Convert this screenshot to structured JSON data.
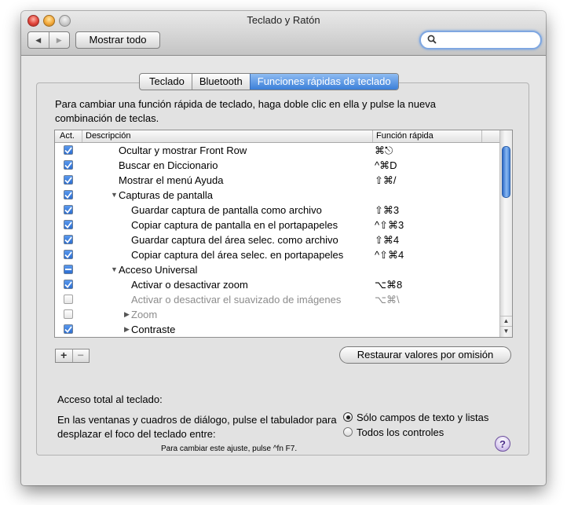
{
  "window": {
    "title": "Teclado y Ratón",
    "show_all_label": "Mostrar todo",
    "search_placeholder": ""
  },
  "tabs": [
    {
      "label": "Teclado",
      "active": false
    },
    {
      "label": "Bluetooth",
      "active": false
    },
    {
      "label": "Funciones rápidas de teclado",
      "active": true
    }
  ],
  "instruction": "Para cambiar una función rápida de teclado, haga doble clic en ella y pulse la nueva combinación de teclas.",
  "table": {
    "headers": {
      "active": "Act.",
      "description": "Descripción",
      "shortcut": "Función rápida"
    },
    "rows": [
      {
        "state": "on",
        "indent": 1,
        "disclosure": "",
        "description": "Ocultar y mostrar Front Row",
        "shortcut": "⌘⎋",
        "dim": false
      },
      {
        "state": "on",
        "indent": 1,
        "disclosure": "",
        "description": "Buscar en Diccionario",
        "shortcut": "^⌘D",
        "dim": false
      },
      {
        "state": "on",
        "indent": 1,
        "disclosure": "",
        "description": "Mostrar el menú Ayuda",
        "shortcut": "⇧⌘/",
        "dim": false
      },
      {
        "state": "on",
        "indent": 0,
        "disclosure": "▼",
        "description": "Capturas de pantalla",
        "shortcut": "",
        "dim": false
      },
      {
        "state": "on",
        "indent": 2,
        "disclosure": "",
        "description": "Guardar captura de pantalla como archivo",
        "shortcut": "⇧⌘3",
        "dim": false
      },
      {
        "state": "on",
        "indent": 2,
        "disclosure": "",
        "description": "Copiar captura de pantalla en el portapapeles",
        "shortcut": "^⇧⌘3",
        "dim": false
      },
      {
        "state": "on",
        "indent": 2,
        "disclosure": "",
        "description": "Guardar captura del área selec. como archivo",
        "shortcut": "⇧⌘4",
        "dim": false
      },
      {
        "state": "on",
        "indent": 2,
        "disclosure": "",
        "description": "Copiar captura del área selec. en portapapeles",
        "shortcut": "^⇧⌘4",
        "dim": false
      },
      {
        "state": "mixed",
        "indent": 0,
        "disclosure": "▼",
        "description": "Acceso Universal",
        "shortcut": "",
        "dim": false
      },
      {
        "state": "on",
        "indent": 2,
        "disclosure": "",
        "description": "Activar o desactivar zoom",
        "shortcut": "⌥⌘8",
        "dim": false
      },
      {
        "state": "off",
        "indent": 2,
        "disclosure": "",
        "description": "Activar o desactivar el suavizado de imágenes",
        "shortcut": "⌥⌘\\",
        "dim": true
      },
      {
        "state": "off",
        "indent": 1,
        "disclosure": "▶",
        "description": "Zoom",
        "shortcut": "",
        "dim": true
      },
      {
        "state": "on",
        "indent": 1,
        "disclosure": "▶",
        "description": "Contraste",
        "shortcut": "",
        "dim": false
      }
    ]
  },
  "buttons": {
    "add": "+",
    "remove": "−",
    "restore": "Restaurar valores por omisión"
  },
  "keyboard_access": {
    "title": "Acceso total al teclado:",
    "description": "En las ventanas y cuadros de diálogo, pulse el tabulador para desplazar el foco del teclado entre:",
    "options": [
      {
        "label": "Sólo campos de texto y listas",
        "selected": true
      },
      {
        "label": "Todos los controles",
        "selected": false
      }
    ],
    "hint": "Para cambiar este ajuste, pulse ^fn F7."
  },
  "help_label": "?"
}
